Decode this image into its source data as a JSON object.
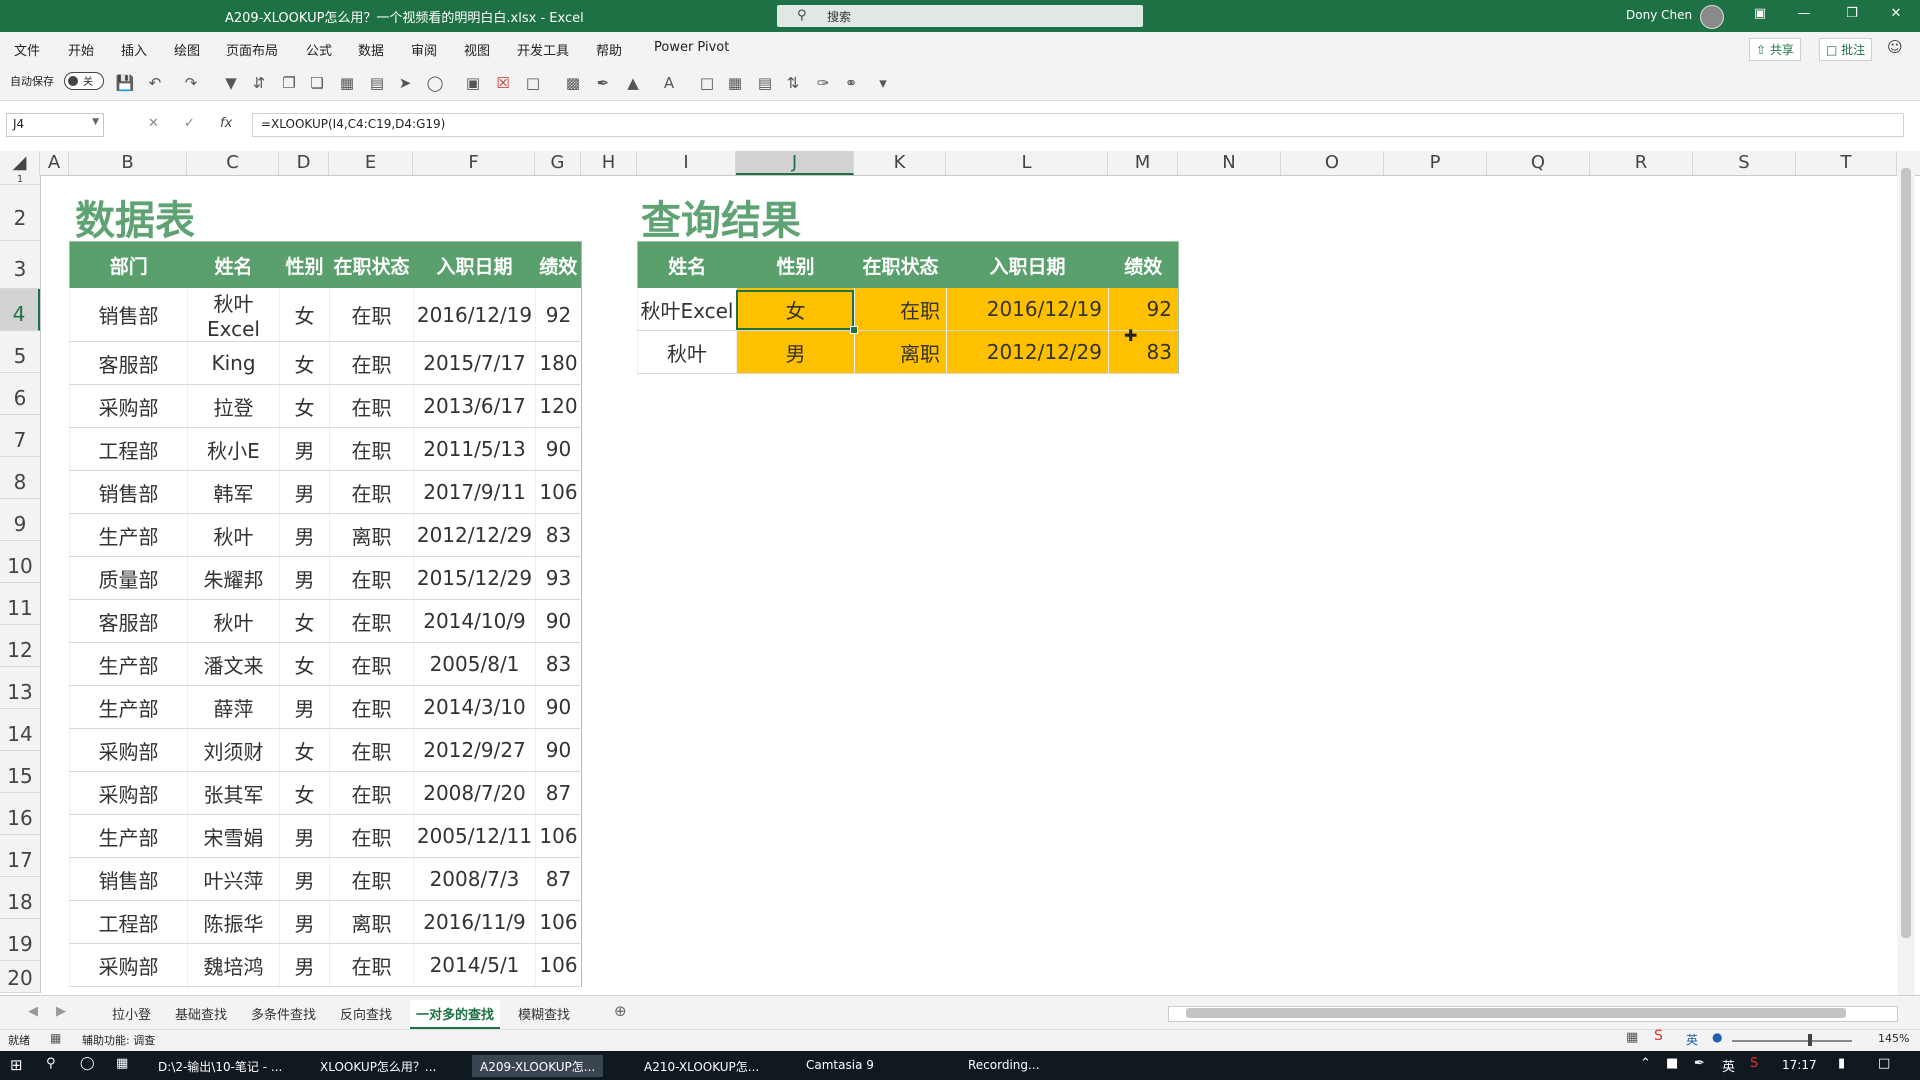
{
  "window": {
    "title": "A209-XLOOKUP怎么用？一个视频看的明明白白.xlsx  -  Excel",
    "search_placeholder": "搜索",
    "user": "Dony Chen",
    "controls": [
      "ribbon-display-icon",
      "minimize-icon",
      "restore-icon",
      "close-icon"
    ]
  },
  "menu": {
    "items": [
      "文件",
      "开始",
      "插入",
      "绘图",
      "页面布局",
      "公式",
      "数据",
      "审阅",
      "视图",
      "开发工具",
      "帮助",
      "Power Pivot"
    ],
    "share": "共享",
    "comment": "批注"
  },
  "qat": {
    "autosave_label": "自动保存",
    "autosave_state": "关"
  },
  "formula_bar": {
    "name_box": "J4",
    "formula": "=XLOOKUP(I4,C4:C19,D4:G19)"
  },
  "grid": {
    "columns": [
      "A",
      "B",
      "C",
      "D",
      "E",
      "F",
      "G",
      "H",
      "I",
      "J",
      "K",
      "L",
      "M",
      "N",
      "O",
      "P",
      "Q",
      "R",
      "S",
      "T"
    ],
    "rows": [
      "1",
      "2",
      "3",
      "4",
      "5",
      "6",
      "7",
      "8",
      "9",
      "10",
      "11",
      "12",
      "13",
      "14",
      "15",
      "16",
      "17",
      "18",
      "19",
      "20"
    ],
    "selected_column": "J",
    "selected_row": "4"
  },
  "data_section": {
    "title": "数据表",
    "headers": [
      "部门",
      "姓名",
      "性别",
      "在职状态",
      "入职日期",
      "绩效"
    ],
    "rows": [
      [
        "销售部",
        "秋叶Excel",
        "女",
        "在职",
        "2016/12/19",
        "92"
      ],
      [
        "客服部",
        "King",
        "女",
        "在职",
        "2015/7/17",
        "180"
      ],
      [
        "采购部",
        "拉登",
        "女",
        "在职",
        "2013/6/17",
        "120"
      ],
      [
        "工程部",
        "秋小E",
        "男",
        "在职",
        "2011/5/13",
        "90"
      ],
      [
        "销售部",
        "韩军",
        "男",
        "在职",
        "2017/9/11",
        "106"
      ],
      [
        "生产部",
        "秋叶",
        "男",
        "离职",
        "2012/12/29",
        "83"
      ],
      [
        "质量部",
        "朱耀邦",
        "男",
        "在职",
        "2015/12/29",
        "93"
      ],
      [
        "客服部",
        "秋叶",
        "女",
        "在职",
        "2014/10/9",
        "90"
      ],
      [
        "生产部",
        "潘文来",
        "女",
        "在职",
        "2005/8/1",
        "83"
      ],
      [
        "生产部",
        "薛萍",
        "男",
        "在职",
        "2014/3/10",
        "90"
      ],
      [
        "采购部",
        "刘须财",
        "女",
        "在职",
        "2012/9/27",
        "90"
      ],
      [
        "采购部",
        "张其军",
        "女",
        "在职",
        "2008/7/20",
        "87"
      ],
      [
        "生产部",
        "宋雪娟",
        "男",
        "在职",
        "2005/12/11",
        "106"
      ],
      [
        "销售部",
        "叶兴萍",
        "男",
        "在职",
        "2008/7/3",
        "87"
      ],
      [
        "工程部",
        "陈振华",
        "男",
        "离职",
        "2016/11/9",
        "106"
      ],
      [
        "采购部",
        "魏培鸿",
        "男",
        "在职",
        "2014/5/1",
        "106"
      ]
    ]
  },
  "result_section": {
    "title": "查询结果",
    "headers": [
      "姓名",
      "性别",
      "在职状态",
      "入职日期",
      "绩效"
    ],
    "rows": [
      [
        "秋叶Excel",
        "女",
        "在职",
        "2016/12/19",
        "92"
      ],
      [
        "秋叶",
        "男",
        "离职",
        "2012/12/29",
        "83"
      ]
    ],
    "highlight_color": "#ffc000"
  },
  "sheet_tabs": {
    "tabs": [
      "拉小登",
      "基础查找",
      "多条件查找",
      "反向查找",
      "一对多的查找",
      "模糊查找"
    ],
    "active": "一对多的查找"
  },
  "status_bar": {
    "ready": "就绪",
    "accessibility": "辅助功能: 调查",
    "zoom": "145%",
    "ime": "英"
  },
  "taskbar": {
    "apps": [
      "D:\\2-输出\\10-笔记 - ...",
      "XLOOKUP怎么用？...",
      "A209-XLOOKUP怎...",
      "A210-XLOOKUP怎...",
      "Camtasia 9",
      "Recording..."
    ],
    "active_app": "A209-XLOOKUP怎...",
    "time": "17:17",
    "ime": "英"
  },
  "colors": {
    "brand": "#1e7145",
    "table_header": "#5aa06d",
    "title_green": "#5fa273",
    "highlight": "#ffc000"
  }
}
